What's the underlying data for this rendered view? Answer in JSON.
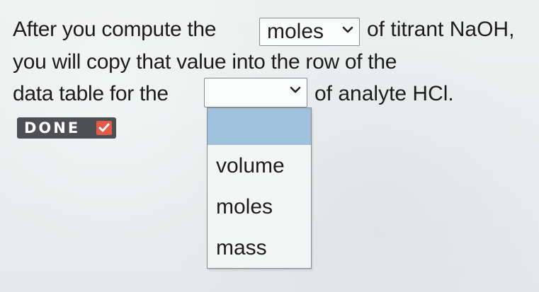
{
  "prompt": {
    "line1_before": "After you compute the",
    "line1_after": "of titrant NaOH,",
    "line2": "you will copy that value into the row of the",
    "line3_before": "data table for the",
    "line3_after": "of analyte HCl."
  },
  "select1": {
    "value": "moles"
  },
  "select2": {
    "value": ""
  },
  "done_button": {
    "label": "DONE"
  },
  "dropdown": {
    "highlighted_option": "",
    "options": [
      "volume",
      "moles",
      "mass"
    ]
  },
  "colors": {
    "highlight": "#9fc1dd",
    "done_bg": "#4d4f52",
    "check_bg": "#e35a48"
  },
  "icons": {
    "chevron": "chevron-down-icon",
    "check": "check-icon"
  }
}
